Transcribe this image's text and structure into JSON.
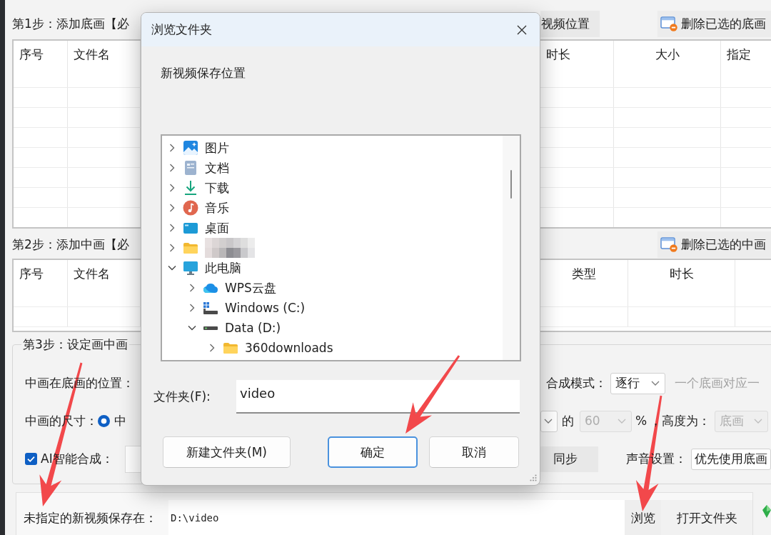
{
  "step1": {
    "title": "第1步：添加底画【必",
    "buttons": [
      {
        "label": "视频位置",
        "kind": "plain"
      },
      {
        "label": "删除已选的底画",
        "kind": "delete"
      }
    ],
    "table": {
      "columns": [
        {
          "label": "序号"
        },
        {
          "label": "文件名"
        },
        {
          "label": "时长"
        },
        {
          "label": "大小"
        },
        {
          "label": "指定"
        }
      ]
    }
  },
  "step2": {
    "title": "第2步：添加中画【必",
    "buttons": [
      {
        "label": "删除已选的中画",
        "kind": "delete"
      }
    ],
    "table": {
      "columns": [
        {
          "label": "序号"
        },
        {
          "label": "文件名"
        },
        {
          "label": "类型"
        },
        {
          "label": "时长"
        }
      ]
    }
  },
  "step3": {
    "title": "第3步：设定画中画",
    "position_label": "中画在底画的位置：",
    "mode": {
      "label": "合成模式：",
      "value": "逐行",
      "disabled": false,
      "hint": "一个底画对应一"
    },
    "size_label": "中画的尺寸：",
    "size_option": {
      "label": "中",
      "selected": true
    },
    "size_of": "的",
    "percent": {
      "value": "60",
      "disabled": true
    },
    "percent_unit": "%",
    "height_label": "，高度为：",
    "height": {
      "value": "底画",
      "disabled": true
    },
    "ai": {
      "label": "AI智能合成：",
      "checked": true
    },
    "sync_option": "同步",
    "sound": {
      "label": "声音设置：",
      "value": "优先使用底画",
      "disabled": false
    }
  },
  "bottom_bar": {
    "label": {
      "text": "未指定的新视频保存在：",
      "pointed_at": true
    },
    "path": "D:\\video",
    "buttons": [
      {
        "label": "浏览",
        "pointed_at": true
      },
      {
        "label": "打开文件夹",
        "pointed_at": false
      }
    ]
  },
  "dialog": {
    "title": "浏览文件夹",
    "prompt": "新视频保存位置",
    "tree": [
      {
        "label": "图片",
        "kind": "pictures",
        "expanded": false
      },
      {
        "label": "文档",
        "kind": "documents",
        "expanded": false
      },
      {
        "label": "下载",
        "kind": "downloads",
        "expanded": false
      },
      {
        "label": "音乐",
        "kind": "music",
        "expanded": false
      },
      {
        "label": "桌面",
        "kind": "desktop",
        "expanded": false
      },
      {
        "kind": "folder",
        "redacted": true,
        "expanded": false
      },
      {
        "label": "此电脑",
        "kind": "computer",
        "expanded": true,
        "children": [
          {
            "label": "WPS云盘",
            "kind": "cloud",
            "expanded": false
          },
          {
            "label": "Windows (C:)",
            "kind": "system-drive",
            "expanded": false
          },
          {
            "label": "Data (D:)",
            "kind": "drive",
            "expanded": true,
            "children": [
              {
                "label": "360downloads",
                "kind": "folder",
                "expanded": false
              }
            ]
          }
        ]
      }
    ],
    "folder_label": "文件夹(F):",
    "folder_value": "video",
    "buttons": [
      {
        "label": "新建文件夹(M)",
        "default": false,
        "pointed_at": false
      },
      {
        "label": "确定",
        "default": true,
        "pointed_at": true
      },
      {
        "label": "取消",
        "default": false,
        "pointed_at": false
      }
    ]
  }
}
